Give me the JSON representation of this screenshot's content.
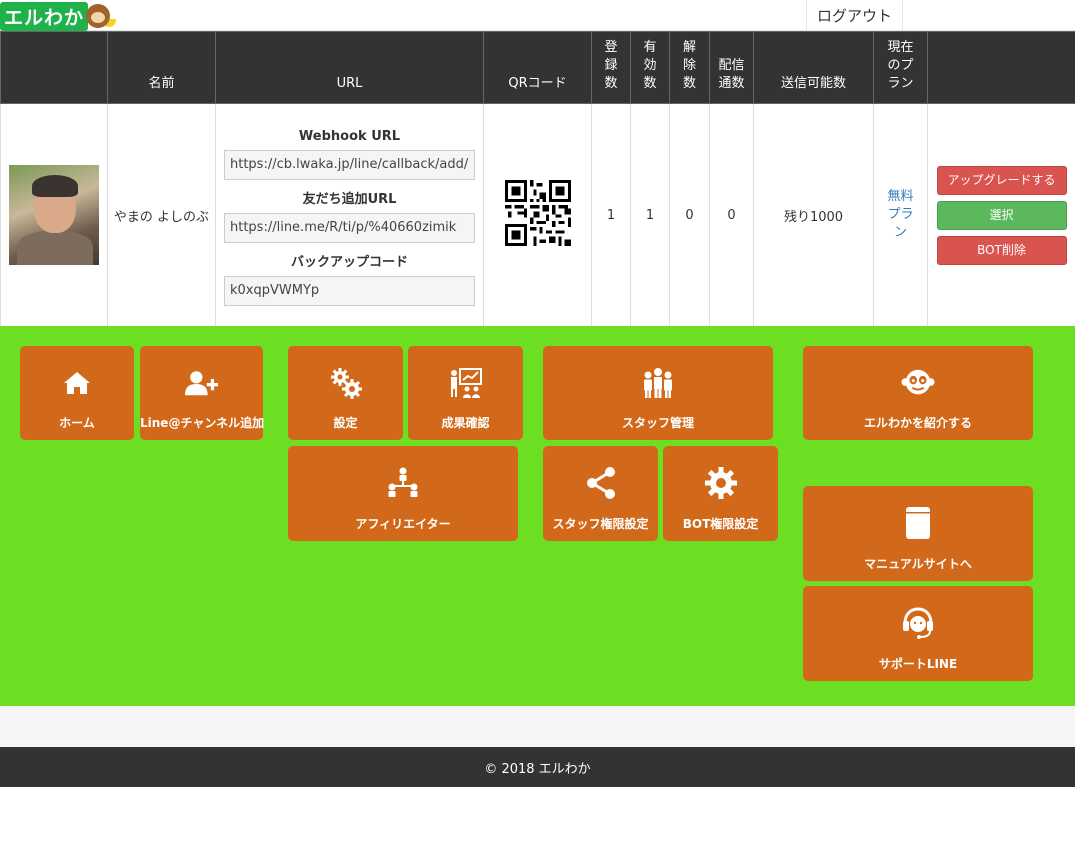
{
  "header": {
    "logo_text": "エルわか",
    "logout_label": "ログアウト"
  },
  "table": {
    "columns": [
      "",
      "名前",
      "URL",
      "QRコード",
      "登\n録\n数",
      "有\n効\n数",
      "解\n除\n数",
      "配信\n通数",
      "送信可能数",
      "現在\nのプ\nラン",
      ""
    ],
    "row": {
      "name": "やまの よしのぶ",
      "webhook_label": "Webhook URL",
      "webhook_value": "https://cb.lwaka.jp/line/callback/add/",
      "friend_label": "友だち追加URL",
      "friend_value": "https://line.me/R/ti/p/%40660zimik",
      "backup_label": "バックアップコード",
      "backup_value": "k0xqpVWMYp",
      "registered": "1",
      "valid": "1",
      "cancelled": "0",
      "deliveries": "0",
      "sendable": "残り1000",
      "plan": "無料\nプラ\nン",
      "buttons": {
        "upgrade": "アップグレードする",
        "select": "選択",
        "delete": "BOT削除"
      }
    }
  },
  "tiles": [
    {
      "label": "ホーム",
      "icon": "home-icon"
    },
    {
      "label": "Line@チャンネル追加",
      "icon": "add-user-icon"
    },
    {
      "label": "設定",
      "icon": "gears-icon"
    },
    {
      "label": "成果確認",
      "icon": "presentation-icon"
    },
    {
      "label": "スタッフ管理",
      "icon": "staff-group-icon"
    },
    {
      "label": "エルわかを紹介する",
      "icon": "monkey-icon"
    },
    {
      "label": "アフィリエイター",
      "icon": "sitemap-icon"
    },
    {
      "label": "スタッフ権限設定",
      "icon": "share-icon"
    },
    {
      "label": "BOT権限設定",
      "icon": "gear-icon"
    },
    {
      "label": "マニュアルサイトへ",
      "icon": "book-icon"
    },
    {
      "label": "サポートLINE",
      "icon": "headset-icon"
    }
  ],
  "footer": {
    "copyright": "© 2018 エルわか"
  },
  "colors": {
    "tile": "#d2691a",
    "panel": "#6ddf22",
    "header_dark": "#333333"
  }
}
